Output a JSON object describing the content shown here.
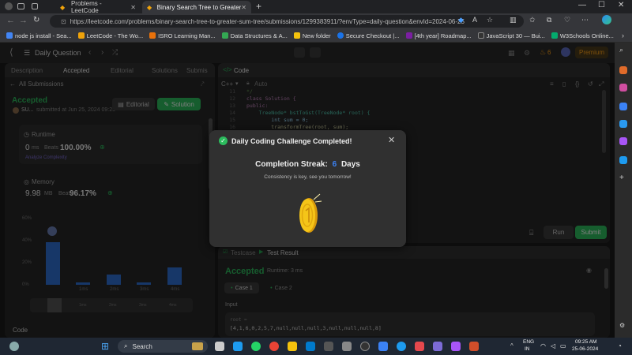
{
  "browser": {
    "tabs": [
      {
        "label": "Problems - LeetCode"
      },
      {
        "label": "Binary Search Tree to Greater Su..."
      }
    ],
    "url": "https://leetcode.com/problems/binary-search-tree-to-greater-sum-tree/submissions/1299383911/?envType=daily-question&envId=2024-06-25",
    "bookmarks": [
      {
        "label": "node js install - Sea...",
        "color": "#4285f4"
      },
      {
        "label": "LeetCode - The Wo...",
        "color": "#f0a30a"
      },
      {
        "label": "ISRO Learning Man...",
        "color": "#e8710a"
      },
      {
        "label": "Data Structures & A...",
        "color": "#34a853"
      },
      {
        "label": "New folder",
        "color": "#f4c20d"
      },
      {
        "label": "Secure Checkout |...",
        "color": "#1a73e8"
      },
      {
        "label": "[4th year] Roadmap...",
        "color": "#7b1fa2"
      },
      {
        "label": "JavaScript 30 — Bui...",
        "color": "#333333"
      },
      {
        "label": "W3Schools Online...",
        "color": "#04aa6d"
      }
    ]
  },
  "lc_header": {
    "title": "Daily Question",
    "streak": "6",
    "premium": "Premium"
  },
  "left": {
    "tabs": [
      "Description",
      "Accepted",
      "Editorial",
      "Solutions",
      "Submis"
    ],
    "back": "All Submissions",
    "status": "Accepted",
    "user": "SU...",
    "submitted": "submitted at Jun 25, 2024 09:25",
    "editorial_btn": "Editorial",
    "solution_btn": "Solution",
    "runtime_label": "Runtime",
    "runtime_value": "0",
    "runtime_unit": "ms",
    "beats_label": "Beats",
    "runtime_beats": "100.00%",
    "analyze": "Analyze Complexity",
    "memory_label": "Memory",
    "memory_value": "9.98",
    "memory_unit": "MB",
    "memory_beats": "96.17%",
    "chart_ticks": [
      "60%",
      "40%",
      "20%",
      "0%"
    ],
    "chart_xlabels": [
      "1ms",
      "2ms",
      "3ms",
      "4ms"
    ],
    "chart_bottom": "Code"
  },
  "editor": {
    "title": "Code",
    "lang": "C++",
    "auto": "Auto",
    "lines": [
      {
        "n": "11",
        "code": "*/"
      },
      {
        "n": "12",
        "code": "class Solution {"
      },
      {
        "n": "13",
        "code": "public:"
      },
      {
        "n": "14",
        "code": "    TreeNode* bstToGst(TreeNode* root) {"
      },
      {
        "n": "15",
        "code": "        int sum = 0;"
      },
      {
        "n": "16",
        "code": "        transformTree(root, sum);"
      }
    ],
    "run": "Run",
    "submit": "Submit"
  },
  "bottom": {
    "tabs": [
      "Testcase",
      "Test Result"
    ],
    "status": "Accepted",
    "runtime": "Runtime: 3 ms",
    "cases": [
      "Case 1",
      "Case 2"
    ],
    "input_label": "Input",
    "root_label": "root =",
    "root_value": "[4,1,6,0,2,5,7,null,null,null,3,null,null,null,8]"
  },
  "modal": {
    "title": "Daily Coding Challenge Completed!",
    "streak_label": "Completion Streak:",
    "streak_value": "6",
    "streak_unit": "Days",
    "message": "Consistency is key, see you tomorrow!"
  },
  "taskbar": {
    "search": "Search",
    "lang1": "ENG",
    "lang2": "IN",
    "time": "09:25 AM",
    "date": "25-06-2024"
  },
  "colors": {
    "accepted": "#2cbb5d",
    "streak_blue": "#3b82f6",
    "premium": "#ffa116"
  }
}
